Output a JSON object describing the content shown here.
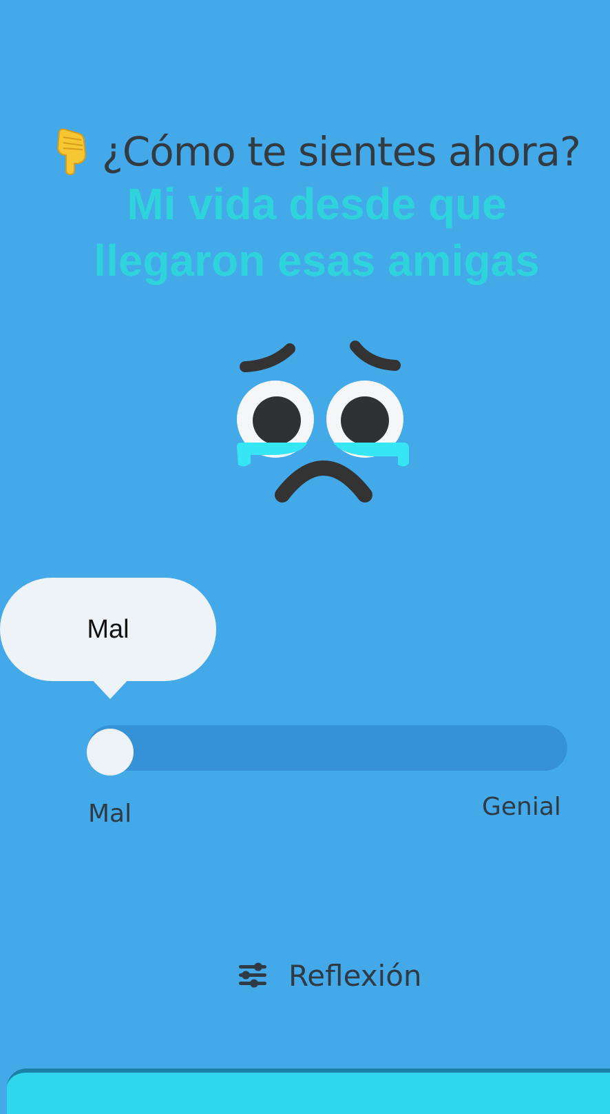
{
  "prompt": {
    "question": "¿Cómo te sientes ahora?",
    "hand_icon": "pointing-down-hand-icon"
  },
  "caption": {
    "text": "Mi vida  desde que\nllegaron esas amigas"
  },
  "mood": {
    "face_icon": "crying-sad-face-icon",
    "bubble_label": "Mal",
    "slider_value": 0,
    "slider_min_label": "Mal",
    "slider_max_label": "Genial"
  },
  "footer": {
    "button_label": "Reflexión",
    "button_icon": "sliders-icon"
  },
  "colors": {
    "background": "#43a9e8",
    "track": "#3592d6",
    "caption": "#2ed3dc",
    "text": "#2f3a44"
  }
}
